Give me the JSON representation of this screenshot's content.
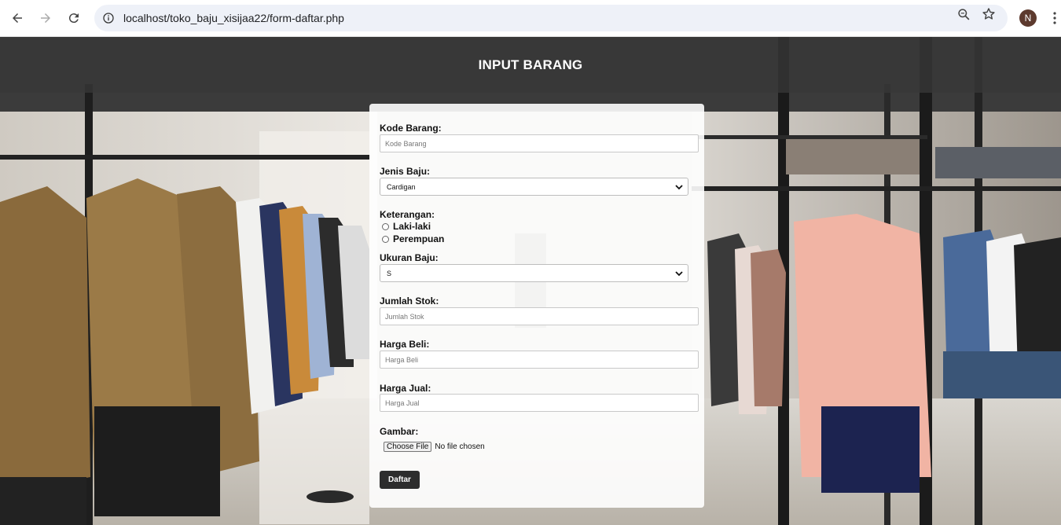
{
  "browser": {
    "url": "localhost/toko_baju_xisijaa22/form-daftar.php",
    "profile_initial": "N"
  },
  "page": {
    "heading": "INPUT BARANG"
  },
  "form": {
    "kode_barang": {
      "label": "Kode Barang:",
      "placeholder": "Kode Barang"
    },
    "jenis_baju": {
      "label": "Jenis Baju:",
      "selected": "Cardigan"
    },
    "keterangan": {
      "label": "Keterangan:",
      "options": [
        "Laki-laki",
        "Perempuan"
      ]
    },
    "ukuran_baju": {
      "label": "Ukuran Baju:",
      "selected": "S"
    },
    "jumlah_stok": {
      "label": "Jumlah Stok:",
      "placeholder": "Jumlah Stok"
    },
    "harga_beli": {
      "label": "Harga Beli:",
      "placeholder": "Harga Beli"
    },
    "harga_jual": {
      "label": "Harga Jual:",
      "placeholder": "Harga Jual"
    },
    "gambar": {
      "label": "Gambar:",
      "button": "Choose File",
      "status": "No file chosen"
    },
    "submit": "Daftar"
  },
  "colors": {
    "header_band": "#373737",
    "submit_bg": "#2d2d2d",
    "avatar_bg": "#5d3a2e"
  }
}
